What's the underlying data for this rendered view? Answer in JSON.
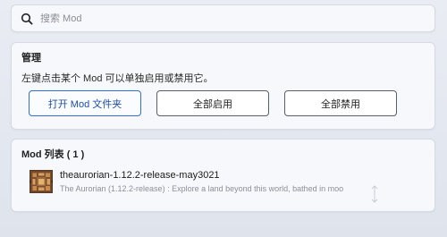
{
  "search": {
    "placeholder": "搜索 Mod"
  },
  "manage": {
    "title": "管理",
    "hint": "左键点击某个 Mod 可以单独启用或禁用它。",
    "buttons": [
      {
        "label": "打开 Mod 文件夹"
      },
      {
        "label": "全部启用"
      },
      {
        "label": "全部禁用"
      }
    ]
  },
  "modlist": {
    "title": "Mod 列表 ( 1 )",
    "items": [
      {
        "name": "theaurorian-1.12.2-release-may3021",
        "description": "The Aurorian (1.12.2-release) : Explore a land beyond this world, bathed in moo",
        "icon": "redstone-lamp-block-icon"
      }
    ]
  },
  "colors": {
    "accent": "#2f6fd6",
    "background": "#e6e9f0",
    "card": "#f7f8fb"
  }
}
